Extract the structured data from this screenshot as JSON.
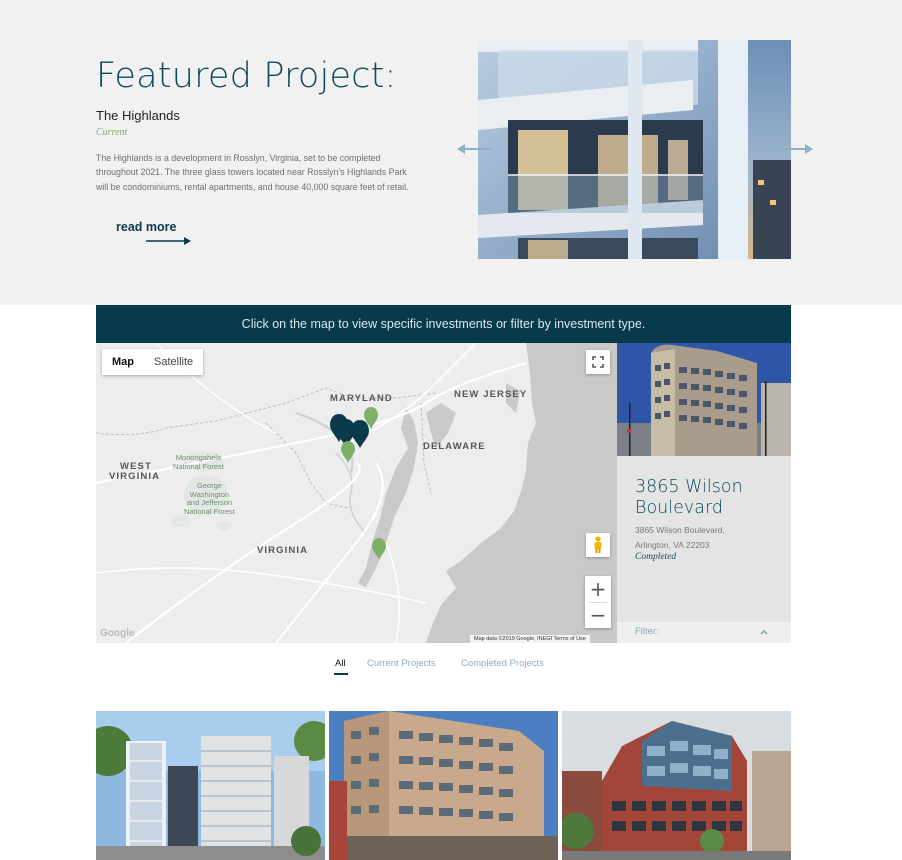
{
  "featured": {
    "heading": "Featured Project:",
    "name": "The Highlands",
    "status": "Current",
    "description": "The Highlands is a development in Rosslyn, Virginia, set to be completed throughout 2021. The three glass towers located near Rosslyn’s Highlands Park will be condominiums, rental apartments, and house 40,000 square feet of retail.",
    "read_more": "read more",
    "arrow_color": "#8fb2c2"
  },
  "map_banner": {
    "text": "Click on the map to view specific investments or filter by investment type."
  },
  "map": {
    "type_map": "Map",
    "type_satellite": "Satellite",
    "labels": {
      "maryland": "MARYLAND",
      "new_jersey": "NEW JERSEY",
      "delaware": "DELAWARE",
      "west_virginia_1": "WEST",
      "west_virginia_2": "VIRGINIA",
      "virginia": "VIRGINIA",
      "monongahela": "Monongahela\nNational Forest",
      "gw_forest": "George\nWashington\nand Jefferson\nNational Forest"
    },
    "attribution": "Map data ©2019 Google, INEGI   Terms of Use",
    "google": "Google",
    "zoom_in": "+",
    "zoom_out": "−",
    "marker_colors": {
      "current": "#7fb069",
      "completed": "#0b3b4b"
    }
  },
  "panel": {
    "title": "3865 Wilson Boulevard",
    "address_line1": "3865 Wilson Boulevard,",
    "address_line2": "Arlington, VA 22203",
    "status": "Completed",
    "filter_label": "Filter:"
  },
  "tabs": {
    "all": "All",
    "current": "Current Projects",
    "completed": "Completed Projects"
  },
  "colors": {
    "brand_dark": "#073b4c",
    "accent_green": "#7fb069",
    "section_bg": "#f1f1f1"
  }
}
